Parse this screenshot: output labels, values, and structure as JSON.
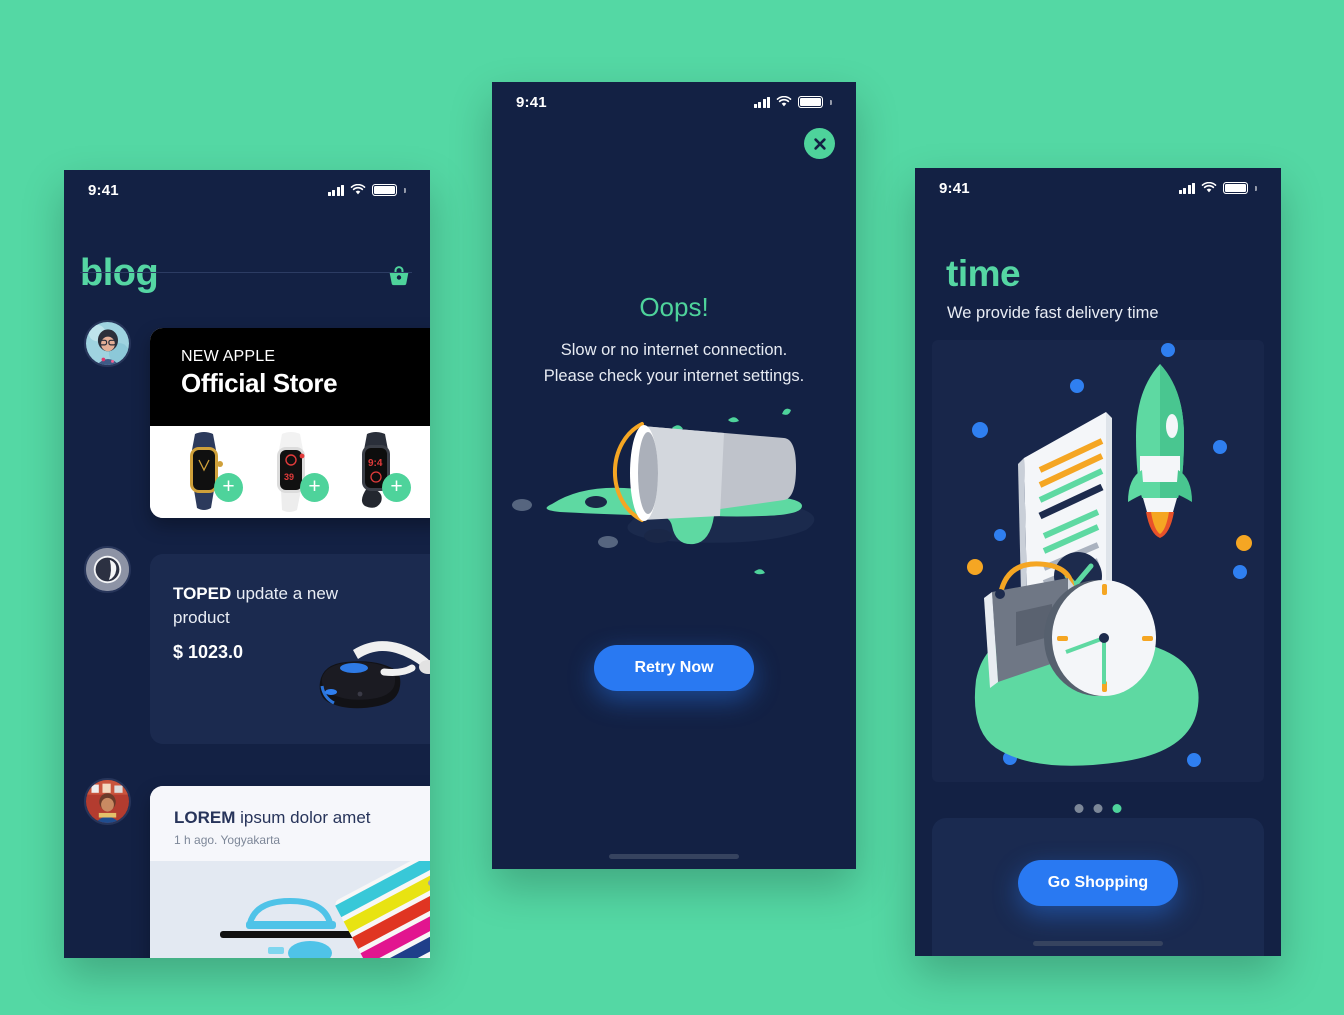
{
  "background_color": "#54d8a4",
  "accent_green": "#4ed39b",
  "accent_blue": "#2979f2",
  "navy": "#132144",
  "phone_blog": {
    "status_bar": {
      "time": "9:41",
      "signal_icon": "cellular-signal-icon",
      "wifi_icon": "wifi-icon",
      "battery_icon": "battery-icon"
    },
    "title": "blog",
    "cart_icon": "shopping-basket-icon",
    "posts": [
      {
        "avatar": "avatar-woman-glasses",
        "type": "apple",
        "kicker": "NEW APPLE",
        "headline": "Official Store",
        "add_button_label": "+",
        "products": [
          "apple-watch-gold",
          "apple-watch-white",
          "apple-watch-black"
        ]
      },
      {
        "avatar": "avatar-tokopedia-logo",
        "type": "toped",
        "brand": "TOPED",
        "text": " update a new product",
        "price": "$ 1023.0",
        "product": "vr-headset"
      },
      {
        "avatar": "avatar-person-market",
        "type": "lorem",
        "brand": "LOREM",
        "text": " ipsum dolor amet",
        "meta": "1 h ago. Yogyakarta",
        "photo": "desk-supplies-photo"
      }
    ]
  },
  "phone_error": {
    "status_bar": {
      "time": "9:41",
      "signal_icon": "cellular-signal-icon",
      "wifi_icon": "wifi-icon",
      "battery_icon": "battery-icon"
    },
    "close_icon": "close-x-icon",
    "title": "Oops!",
    "message_line_1": "Slow or no internet connection.",
    "message_line_2": "Please check your internet settings.",
    "illustration": "spilled-cup-illustration",
    "retry_label": "Retry Now"
  },
  "phone_time": {
    "status_bar": {
      "time": "9:41",
      "signal_icon": "cellular-signal-icon",
      "wifi_icon": "wifi-icon",
      "battery_icon": "battery-icon"
    },
    "title": "time",
    "subtitle": "We provide fast delivery time",
    "illustration": "rocket-document-clock-bag-illustration",
    "pagination": {
      "total": 3,
      "active_index": 2
    },
    "cta_label": "Go Shopping"
  }
}
